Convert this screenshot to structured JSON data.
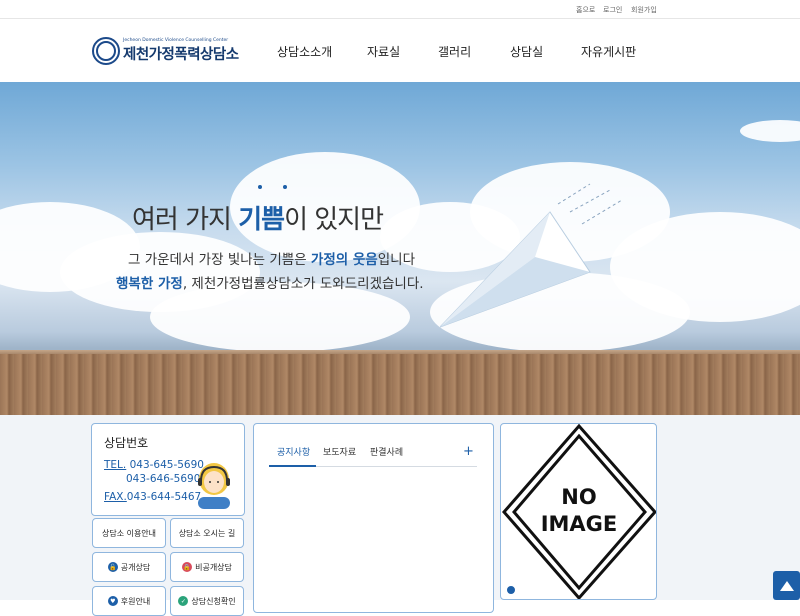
{
  "util_links": [
    "홈으로",
    "로그인",
    "회원가입"
  ],
  "logo": {
    "english": "Jecheon Domestic Violence Counselling Center",
    "korean": "제천가정폭력상담소"
  },
  "nav": [
    "상담소소개",
    "자료실",
    "갤러리",
    "상담실",
    "자유게시판"
  ],
  "hero": {
    "title_pre": "여러 가지 ",
    "title_hl": "기쁨",
    "title_post": "이 있지만",
    "line1_pre": "그 가운데서 가장 빛나는 기쁨은 ",
    "line1_hl": "가정의 웃음",
    "line1_post": "입니다",
    "line2_hl": "행복한 가정",
    "line2_post": ", 제천가정법률상담소가 도와드리겠습니다."
  },
  "contact": {
    "title": "상담번호",
    "tel_label": "TEL.",
    "tel1": "043-645-5690",
    "tel2": "043-646-5690",
    "fax_label": "FAX.",
    "fax": "043-644-5467"
  },
  "quick_buttons": [
    "상담소 이용안내",
    "상담소 오시는 길",
    "공개상담",
    "비공개상담",
    "후원안내",
    "상담신청확인"
  ],
  "board": {
    "tabs": [
      "공지사항",
      "보도자료",
      "판결사례"
    ],
    "more": "+"
  },
  "no_image": {
    "line1": "NO",
    "line2": "IMAGE"
  },
  "colors": {
    "brand": "#1d5fa8",
    "logo": "#153a6e",
    "box_border": "#8fb6de",
    "content_bg": "#f1f4f8"
  }
}
